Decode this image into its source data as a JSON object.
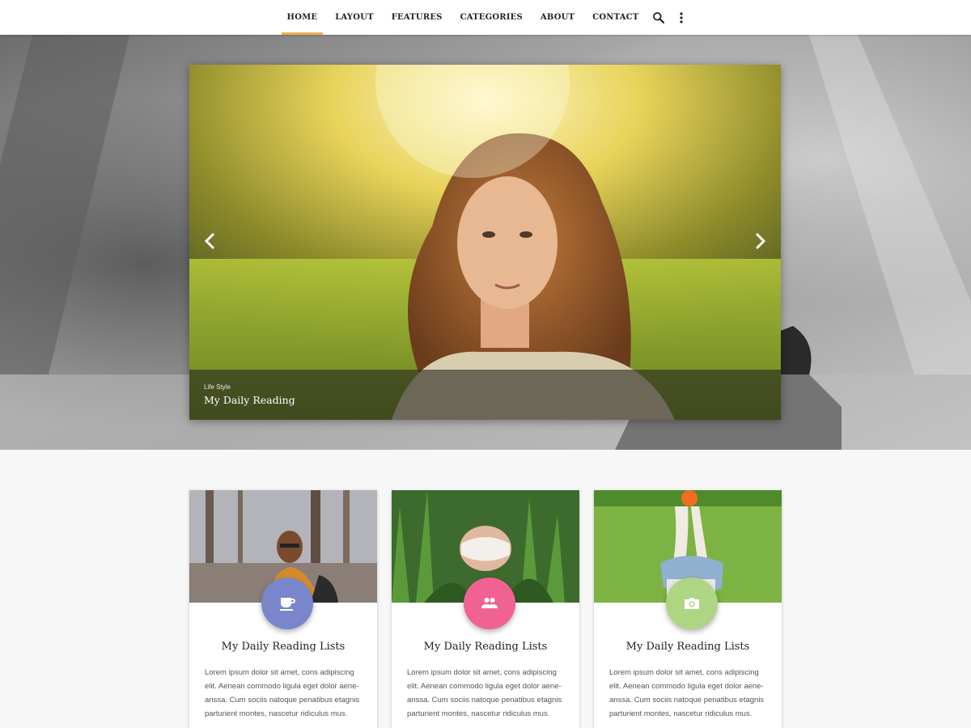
{
  "nav": {
    "items": [
      {
        "label": "HOME",
        "active": true
      },
      {
        "label": "LAYOUT",
        "active": false
      },
      {
        "label": "FEATURES",
        "active": false
      },
      {
        "label": "CATEGORIES",
        "active": false
      },
      {
        "label": "ABOUT",
        "active": false
      },
      {
        "label": "CONTACT",
        "active": false
      }
    ],
    "icons": [
      "search-icon",
      "more-vert-icon"
    ],
    "accent": "#f0b24a"
  },
  "slider": {
    "category": "Life Style",
    "title": "My Daily Reading",
    "icons": [
      "chevron-left-icon",
      "chevron-right-icon"
    ]
  },
  "cards": [
    {
      "title": "My Daily Reading Lists",
      "text": "Lorem ipsum dolor sit amet, cons adipiscing elit. Aenean commodo ligula eget dolor aene-anssa. Cum sociis natoque penatibus etagnis parturient montes, nascetur ridiculus mus.",
      "icon": "coffee-icon",
      "color": "#7986cb"
    },
    {
      "title": "My Daily Reading Lists",
      "text": "Lorem ipsum dolor sit amet, cons adipiscing elit. Aenean commodo ligula eget dolor aene-anssa. Cum sociis natoque penatibus etagnis parturient montes, nascetur ridiculus mus.",
      "icon": "group-icon",
      "color": "#f06292"
    },
    {
      "title": "My Daily Reading Lists",
      "text": "Lorem ipsum dolor sit amet, cons adipiscing elit. Aenean commodo ligula eget dolor aene-anssa. Cum sociis natoque penatibus etagnis parturient montes, nascetur ridiculus mus.",
      "icon": "camera-icon",
      "color": "#aed581"
    }
  ]
}
